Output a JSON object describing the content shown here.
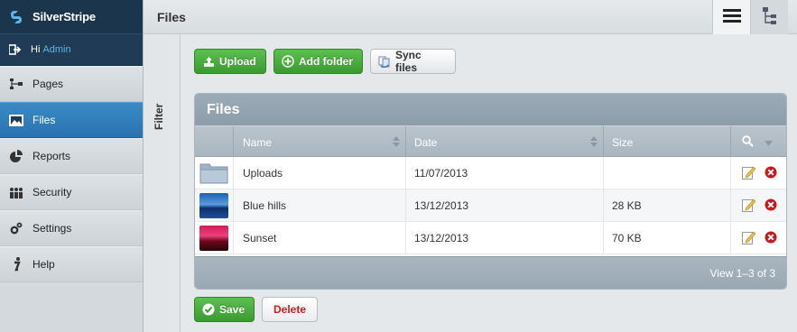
{
  "brand": {
    "name": "SilverStripe"
  },
  "user": {
    "greeting": "Hi",
    "name": "Admin"
  },
  "sidebar": {
    "items": [
      {
        "label": "Pages",
        "icon": "sitemap-icon",
        "active": false
      },
      {
        "label": "Files",
        "icon": "image-icon",
        "active": true
      },
      {
        "label": "Reports",
        "icon": "pie-chart-icon",
        "active": false
      },
      {
        "label": "Security",
        "icon": "users-icon",
        "active": false
      },
      {
        "label": "Settings",
        "icon": "gear-icon",
        "active": false
      },
      {
        "label": "Help",
        "icon": "info-icon",
        "active": false
      }
    ]
  },
  "filter": {
    "label": "Filter"
  },
  "header": {
    "title": "Files"
  },
  "toolbar": {
    "upload_label": "Upload",
    "add_folder_label": "Add folder",
    "sync_label": "Sync files"
  },
  "grid": {
    "title": "Files",
    "columns": {
      "name": "Name",
      "date": "Date",
      "size": "Size"
    },
    "rows": [
      {
        "type": "folder",
        "name": "Uploads",
        "date": "11/07/2013",
        "size": ""
      },
      {
        "type": "image-blue",
        "name": "Blue hills",
        "date": "13/12/2013",
        "size": "28 KB"
      },
      {
        "type": "image-red",
        "name": "Sunset",
        "date": "13/12/2013",
        "size": "70 KB"
      }
    ],
    "pagination": "View 1–3 of 3"
  },
  "actions": {
    "save_label": "Save",
    "delete_label": "Delete"
  },
  "colors": {
    "nav_dark": "#1b354c",
    "active_blue": "#2a72b0",
    "green": "#3b9a31",
    "delete_red": "#cc1a1a"
  }
}
